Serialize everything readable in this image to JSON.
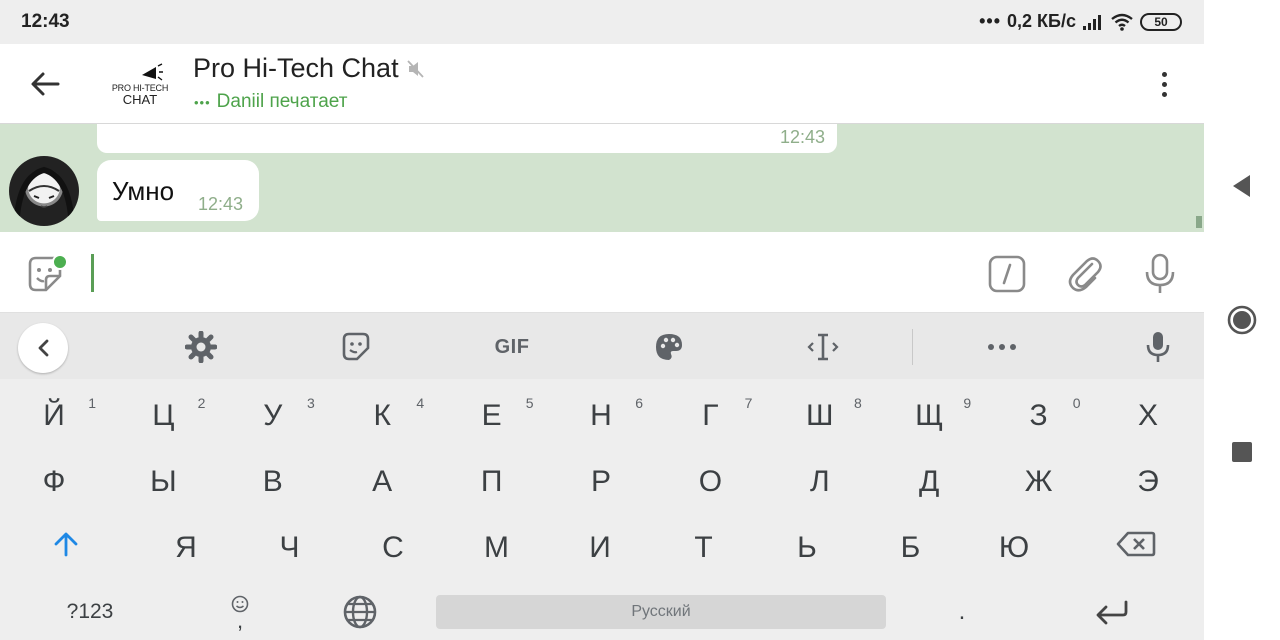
{
  "status_bar": {
    "time": "12:43",
    "network_speed": "0,2 КБ/с",
    "dots": "•••",
    "battery": "50"
  },
  "header": {
    "chat_title": "Pro Hi-Tech Chat",
    "status_text": "Daniil печатает",
    "typing_dots": "•••",
    "logo_line1": "PRO HI-TECH",
    "logo_line2": "CHAT"
  },
  "messages": [
    {
      "text": "",
      "time": "12:43"
    },
    {
      "text": "Умно",
      "time": "12:43"
    }
  ],
  "composer": {
    "value": ""
  },
  "keyboard": {
    "toolbar": {
      "gif_label": "GIF"
    },
    "row1": [
      {
        "label": "Й",
        "hint": "1"
      },
      {
        "label": "Ц",
        "hint": "2"
      },
      {
        "label": "У",
        "hint": "3"
      },
      {
        "label": "К",
        "hint": "4"
      },
      {
        "label": "Е",
        "hint": "5"
      },
      {
        "label": "Н",
        "hint": "6"
      },
      {
        "label": "Г",
        "hint": "7"
      },
      {
        "label": "Ш",
        "hint": "8"
      },
      {
        "label": "Щ",
        "hint": "9"
      },
      {
        "label": "З",
        "hint": "0"
      },
      {
        "label": "Х",
        "hint": ""
      }
    ],
    "row2": [
      "Ф",
      "Ы",
      "В",
      "А",
      "П",
      "Р",
      "О",
      "Л",
      "Д",
      "Ж",
      "Э"
    ],
    "row3": [
      "Я",
      "Ч",
      "С",
      "М",
      "И",
      "Т",
      "Ь",
      "Б",
      "Ю"
    ],
    "bottom": {
      "symbols_label": "?123",
      "comma_label": ",",
      "space_label": "Русский",
      "period_label": "."
    }
  },
  "colors": {
    "accent_green": "#4ea34b",
    "chat_background": "#d2e3cf",
    "shift_blue": "#1e88e5"
  },
  "icons": {
    "back": "arrow-left-icon",
    "mute": "volume-off-icon",
    "menu": "more-vertical-icon",
    "sticker": "sticker-icon",
    "command": "slash-command-icon",
    "attach": "paperclip-icon",
    "mic": "microphone-icon",
    "settings": "gear-icon",
    "palette": "palette-icon",
    "cursor": "text-cursor-icon",
    "more": "more-horizontal-icon",
    "shift": "shift-arrow-icon",
    "backspace": "backspace-icon",
    "globe": "globe-icon",
    "enter": "enter-icon",
    "emoji": "smile-icon"
  }
}
